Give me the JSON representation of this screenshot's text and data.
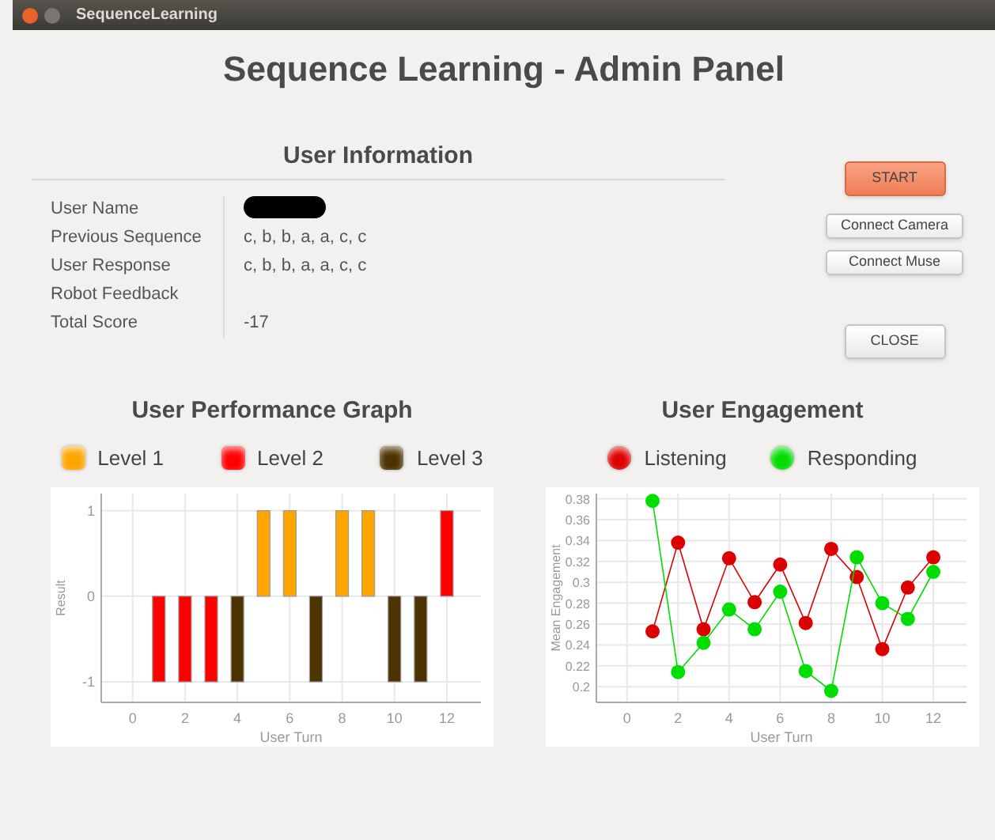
{
  "window": {
    "title": "SequenceLearning"
  },
  "heading": "Sequence Learning - Admin Panel",
  "user_information": {
    "title": "User Information",
    "fields": [
      {
        "label": "User Name",
        "redacted": true
      },
      {
        "label": "Previous Sequence",
        "value": "c, b, b, a, a, c, c"
      },
      {
        "label": "User Response",
        "value": "c, b, b, a, a, c, c"
      },
      {
        "label": "Robot Feedback"
      },
      {
        "label": "Total Score",
        "value": "-17"
      }
    ]
  },
  "buttons": [
    {
      "label": "START",
      "kind": "primary"
    },
    {
      "label": "Connect Camera",
      "kind": "small"
    },
    {
      "label": "Connect Muse",
      "kind": "small"
    },
    {
      "label": "CLOSE",
      "kind": "large"
    }
  ],
  "performance": {
    "title": "User Performance Graph",
    "chart_data": {
      "type": "bar",
      "xlabel": "User Turn",
      "ylabel": "Result",
      "grid": true,
      "x": [
        1,
        2,
        3,
        4,
        5,
        6,
        7,
        8,
        9,
        10,
        11,
        12
      ],
      "xlim": [
        -1.2,
        13.3
      ],
      "ylim": [
        -1.24,
        1.2
      ],
      "xticks": [
        0,
        2,
        4,
        6,
        8,
        10,
        12
      ],
      "yticks": [
        -1,
        0,
        1
      ],
      "series": [
        {
          "name": "Level 1",
          "color": "#ffa500",
          "values": [
            null,
            null,
            null,
            null,
            1,
            1,
            null,
            1,
            1,
            null,
            null,
            null
          ]
        },
        {
          "name": "Level 2",
          "color": "#ff0000",
          "values": [
            -1,
            -1,
            -1,
            null,
            null,
            null,
            null,
            null,
            null,
            null,
            null,
            1
          ]
        },
        {
          "name": "Level 3",
          "color": "#4d3300",
          "values": [
            null,
            null,
            null,
            -1,
            null,
            null,
            -1,
            null,
            null,
            -1,
            -1,
            null
          ]
        }
      ]
    }
  },
  "engagement": {
    "title": "User Engagement",
    "chart_data": {
      "type": "line",
      "xlabel": "User Turn",
      "ylabel": "Mean Engagement",
      "grid": true,
      "x": [
        1,
        2,
        3,
        4,
        5,
        6,
        7,
        8,
        9,
        10,
        11,
        12
      ],
      "xlim": [
        -1.2,
        13.3
      ],
      "ylim": [
        0.185,
        0.385
      ],
      "xticks": [
        0,
        2,
        4,
        6,
        8,
        10,
        12
      ],
      "yticks": [
        {
          "value": 0.2,
          "label": "0.2"
        },
        {
          "value": 0.22,
          "label": "0.22"
        },
        {
          "value": 0.24,
          "label": "0.24"
        },
        {
          "value": 0.26,
          "label": "0.26"
        },
        {
          "value": 0.28,
          "label": "0.28"
        },
        {
          "value": 0.3,
          "label": "0.3"
        },
        {
          "value": 0.32,
          "label": "0.32"
        },
        {
          "value": 0.34,
          "label": "0.34"
        },
        {
          "value": 0.36,
          "label": "0.36"
        },
        {
          "value": 0.38,
          "label": "0.38"
        }
      ],
      "series": [
        {
          "name": "Listening",
          "color": "#dd0000",
          "marker": "circle",
          "values": [
            0.253,
            0.338,
            0.255,
            0.323,
            0.281,
            0.317,
            0.261,
            0.332,
            0.305,
            0.236,
            0.295,
            0.324
          ]
        },
        {
          "name": "Responding",
          "color": "#00dd00",
          "marker": "circle",
          "values": [
            0.378,
            0.214,
            0.242,
            0.274,
            0.255,
            0.291,
            0.215,
            0.196,
            0.324,
            0.28,
            0.265,
            0.31
          ]
        }
      ]
    }
  }
}
